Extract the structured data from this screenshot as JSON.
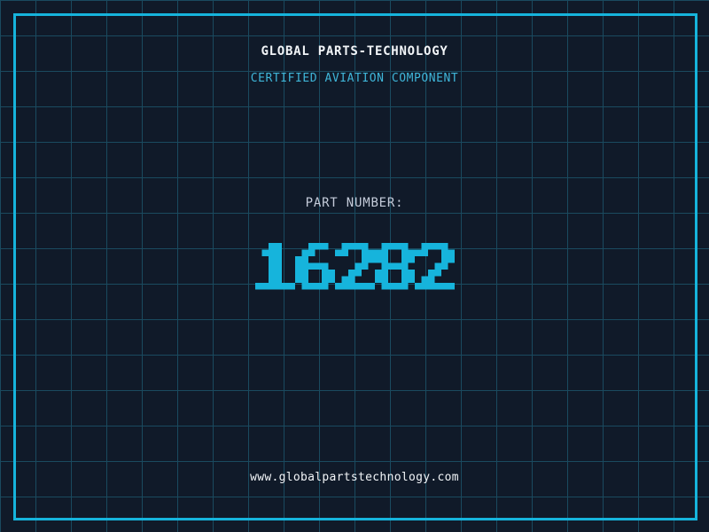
{
  "header": {
    "company_name": "GLOBAL PARTS-TECHNOLOGY",
    "certification_label": "CERTIFIED AVIATION COMPONENT"
  },
  "part": {
    "label": "PART NUMBER:",
    "number": "16282"
  },
  "footer": {
    "website": "www.globalpartstechnology.com"
  },
  "colors": {
    "background": "#101a29",
    "grid_line": "#1a4a5f",
    "accent": "#16b4dc",
    "accent_light": "#3fb6d9",
    "label_text": "#c5ccda",
    "primary_text": "#f2f5f8"
  }
}
